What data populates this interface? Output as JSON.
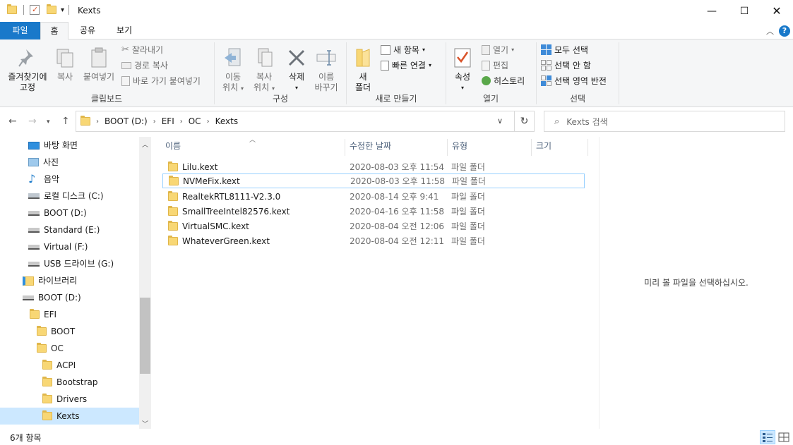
{
  "window": {
    "title": "Kexts"
  },
  "ribbon_tabs": [
    "파일",
    "홈",
    "공유",
    "보기"
  ],
  "clipboard": {
    "pin": [
      "즐겨찾기에",
      "고정"
    ],
    "copy": "복사",
    "paste": "붙여넣기",
    "cut": "잘라내기",
    "copy_path": "경로 복사",
    "paste_shortcut": "바로 가기 붙여넣기",
    "label": "클립보드"
  },
  "organize": {
    "move": [
      "이동",
      "위치"
    ],
    "copyto": [
      "복사",
      "위치"
    ],
    "delete": "삭제",
    "rename": [
      "이름",
      "바꾸기"
    ],
    "label": "구성"
  },
  "new": {
    "folder": [
      "새",
      "폴더"
    ],
    "new_item": "새 항목",
    "easy_access": "빠른 연결",
    "label": "새로 만들기"
  },
  "open": {
    "properties": "속성",
    "open": "열기",
    "edit": "편집",
    "history": "히스토리",
    "label": "열기"
  },
  "select": {
    "all": "모두 선택",
    "none": "선택 안 함",
    "invert": "선택 영역 반전",
    "label": "선택"
  },
  "address": {
    "crumbs": [
      "BOOT (D:)",
      "EFI",
      "OC",
      "Kexts"
    ],
    "search_placeholder": "Kexts 검색"
  },
  "nav": [
    {
      "label": "바탕 화면",
      "icon": "desktop-icon"
    },
    {
      "label": "사진",
      "icon": "pictures-icon"
    },
    {
      "label": "음악",
      "icon": "music-icon"
    },
    {
      "label": "로컬 디스크 (C:)",
      "icon": "windows-drive-icon"
    },
    {
      "label": "BOOT (D:)",
      "icon": "drive-icon"
    },
    {
      "label": "Standard (E:)",
      "icon": "drive-icon"
    },
    {
      "label": "Virtual (F:)",
      "icon": "drive-icon"
    },
    {
      "label": "USB 드라이브 (G:)",
      "icon": "usb-drive-icon"
    },
    {
      "label": "라이브러리",
      "icon": "library-icon"
    },
    {
      "label": "BOOT (D:)",
      "icon": "drive-icon"
    },
    {
      "label": "EFI",
      "icon": "folder-icon"
    },
    {
      "label": "BOOT",
      "icon": "folder-icon"
    },
    {
      "label": "OC",
      "icon": "folder-icon"
    },
    {
      "label": "ACPI",
      "icon": "folder-icon"
    },
    {
      "label": "Bootstrap",
      "icon": "folder-icon"
    },
    {
      "label": "Drivers",
      "icon": "folder-icon"
    },
    {
      "label": "Kexts",
      "icon": "folder-icon"
    }
  ],
  "columns": [
    "이름",
    "수정한 날짜",
    "유형",
    "크기"
  ],
  "files": [
    {
      "name": "Lilu.kext",
      "date": "2020-08-03 오후 11:54",
      "type": "파일 폴더"
    },
    {
      "name": "NVMeFix.kext",
      "date": "2020-08-03 오후 11:58",
      "type": "파일 폴더"
    },
    {
      "name": "RealtekRTL8111-V2.3.0",
      "date": "2020-08-14 오후 9:41",
      "type": "파일 폴더"
    },
    {
      "name": "SmallTreeIntel82576.kext",
      "date": "2020-04-16 오후 11:58",
      "type": "파일 폴더"
    },
    {
      "name": "VirtualSMC.kext",
      "date": "2020-08-04 오전 12:06",
      "type": "파일 폴더"
    },
    {
      "name": "WhateverGreen.kext",
      "date": "2020-08-04 오전 12:11",
      "type": "파일 폴더"
    }
  ],
  "preview_text": "미리 볼 파일을 선택하십시오.",
  "status": {
    "count": "6개 항목"
  },
  "colors": {
    "accent": "#1979ca",
    "selection": "#cce8ff",
    "folder": "#f8d775"
  }
}
